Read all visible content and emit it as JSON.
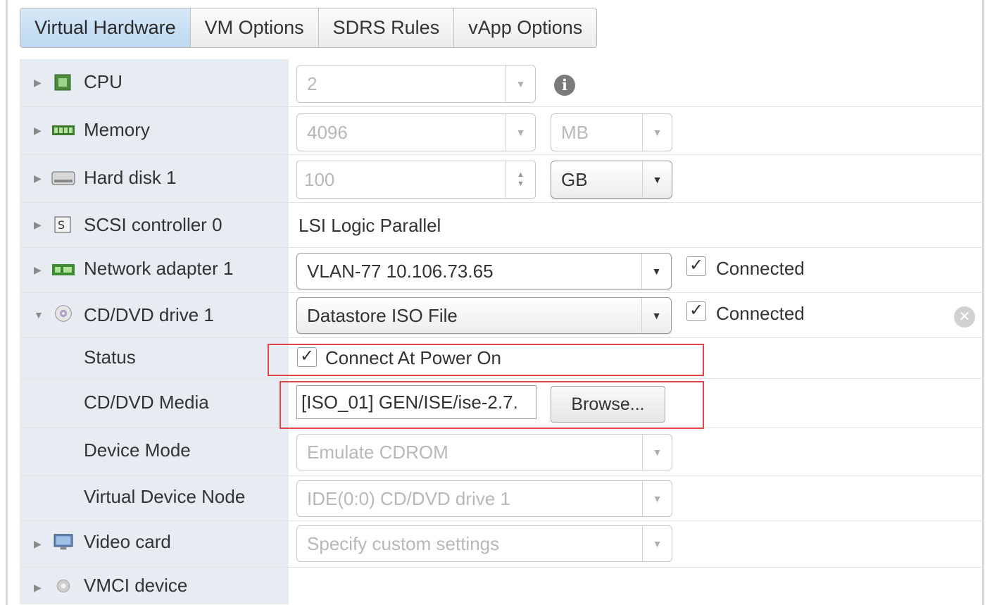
{
  "tabs": [
    {
      "label": "Virtual Hardware",
      "active": true
    },
    {
      "label": "VM Options",
      "active": false
    },
    {
      "label": "SDRS Rules",
      "active": false
    },
    {
      "label": "vApp Options",
      "active": false
    }
  ],
  "devices": {
    "cpu": {
      "label": "CPU",
      "value": "2",
      "icon": "cpu-icon"
    },
    "memory": {
      "label": "Memory",
      "value": "4096",
      "unit": "MB",
      "icon": "memory-icon"
    },
    "hard_disk": {
      "label": "Hard disk 1",
      "value": "100",
      "unit": "GB",
      "icon": "hard-disk-icon"
    },
    "scsi": {
      "label": "SCSI controller 0",
      "value": "LSI Logic Parallel",
      "icon": "scsi-controller-icon"
    },
    "network": {
      "label": "Network adapter 1",
      "value": "VLAN-77 10.106.73.65",
      "connected_label": "Connected",
      "connected": true,
      "icon": "network-adapter-icon"
    },
    "cddvd": {
      "label": "CD/DVD drive 1",
      "value": "Datastore ISO File",
      "connected_label": "Connected",
      "connected": true,
      "icon": "cd-dvd-icon",
      "status_label": "Status",
      "connect_power_on_label": "Connect At Power On",
      "media_label": "CD/DVD Media",
      "media_value": "[ISO_01] GEN/ISE/ise-2.7.",
      "browse_label": "Browse...",
      "device_mode_label": "Device Mode",
      "device_mode_value": "Emulate CDROM",
      "node_label": "Virtual Device Node",
      "node_value": "IDE(0:0) CD/DVD drive 1"
    },
    "video": {
      "label": "Video card",
      "value": "Specify custom settings",
      "icon": "video-card-icon"
    },
    "vmci": {
      "label": "VMCI device",
      "icon": "vmci-device-icon"
    }
  },
  "colors": {
    "highlight": "#e0454a",
    "active_tab": "#c9e0f4",
    "label_column": "#e6ecf2"
  }
}
